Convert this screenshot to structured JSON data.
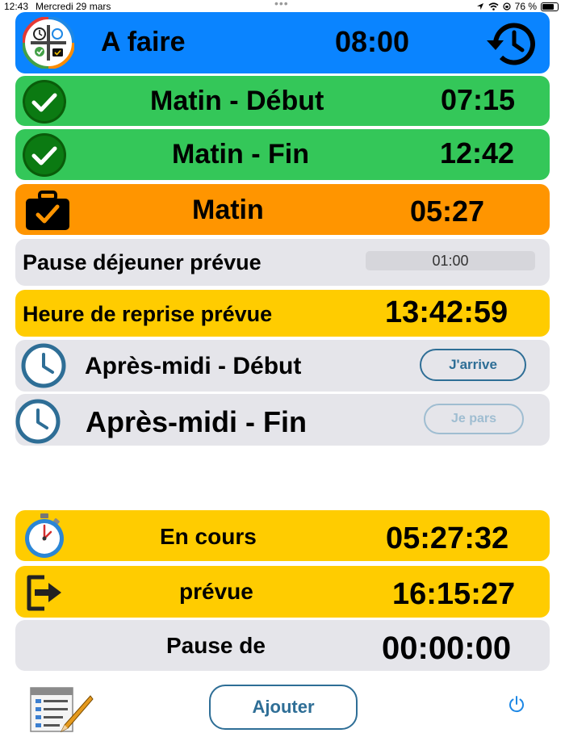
{
  "status": {
    "time": "12:43",
    "date": "Mercredi 29 mars",
    "battery": "76 %"
  },
  "header": {
    "title": "A faire",
    "time": "08:00",
    "color": "#0a84ff"
  },
  "rows": {
    "matin_debut": {
      "label": "Matin - Début",
      "time": "07:15",
      "color": "#34c759"
    },
    "matin_fin": {
      "label": "Matin - Fin",
      "time": "12:42",
      "color": "#34c759"
    },
    "matin": {
      "label": "Matin",
      "time": "05:27",
      "color": "#ff9500"
    },
    "pause_prevue": {
      "label": "Pause déjeuner prévue",
      "value": "01:00",
      "color": "#e5e5ea"
    },
    "reprise": {
      "label": "Heure de reprise prévue",
      "time": "13:42:59",
      "color": "#ffcc00"
    },
    "apm_debut": {
      "label": "Après-midi - Début",
      "button": "J'arrive"
    },
    "apm_fin": {
      "label": "Après-midi - Fin",
      "button": "Je pars"
    }
  },
  "summary": {
    "en_cours": {
      "label": "En cours",
      "time": "05:27:32"
    },
    "prevue": {
      "label": "prévue",
      "time": "16:15:27"
    },
    "pause_de": {
      "label": "Pause de",
      "time": "00:00:00"
    }
  },
  "footer": {
    "add_button": "Ajouter"
  },
  "icons": {
    "app_logo": "app-logo-icon",
    "history": "history-icon",
    "check": "check-circle-icon",
    "briefcase": "briefcase-check-icon",
    "clock": "clock-icon",
    "stopwatch": "stopwatch-icon",
    "exit": "exit-icon",
    "notes": "notes-pencil-icon",
    "power": "power-icon"
  }
}
